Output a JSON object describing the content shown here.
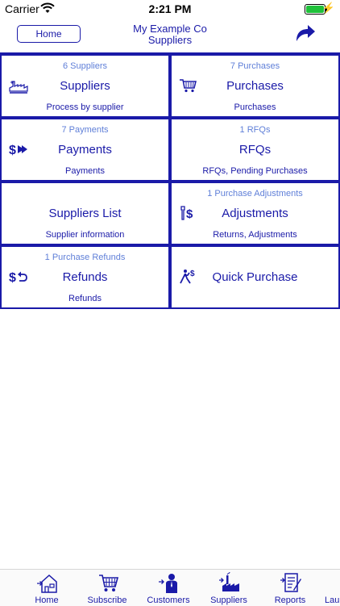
{
  "status_bar": {
    "carrier": "Carrier",
    "time": "2:21 PM"
  },
  "header": {
    "home_label": "Home",
    "company": "My Example Co",
    "section": "Suppliers"
  },
  "tiles": [
    {
      "count": "6 Suppliers",
      "title": "Suppliers",
      "subtitle": "Process by supplier",
      "icon": "supplier-factory-icon"
    },
    {
      "count": "7 Purchases",
      "title": "Purchases",
      "subtitle": "Purchases",
      "icon": "shopping-cart-icon"
    },
    {
      "count": "7 Payments",
      "title": "Payments",
      "subtitle": "Payments",
      "icon": "payment-dollar-icon"
    },
    {
      "count": "1 RFQs",
      "title": "RFQs",
      "subtitle": "RFQs, Pending Purchases",
      "icon": ""
    },
    {
      "count": "",
      "title": "Suppliers List",
      "subtitle": "Supplier information",
      "icon": ""
    },
    {
      "count": "1 Purchase Adjustments",
      "title": "Adjustments",
      "subtitle": "Returns, Adjustments",
      "icon": "adjustment-dollar-icon"
    },
    {
      "count": "1 Purchase Refunds",
      "title": "Refunds",
      "subtitle": "Refunds",
      "icon": "refund-dollar-icon"
    },
    {
      "count": "",
      "title": "Quick Purchase",
      "subtitle": "",
      "icon": "quick-purchase-icon"
    }
  ],
  "tabbar": [
    {
      "label": "Home",
      "icon": "house-icon"
    },
    {
      "label": "Subscribe",
      "icon": "cart-icon"
    },
    {
      "label": "Customers",
      "icon": "customer-person-icon"
    },
    {
      "label": "Suppliers",
      "icon": "factory-icon"
    },
    {
      "label": "Reports",
      "icon": "report-document-icon"
    },
    {
      "label": "Lau",
      "icon": "launch-icon"
    }
  ],
  "colors": {
    "accent": "#1a1aa8",
    "count_text": "#5f7fd8",
    "battery": "#1fc13a"
  }
}
